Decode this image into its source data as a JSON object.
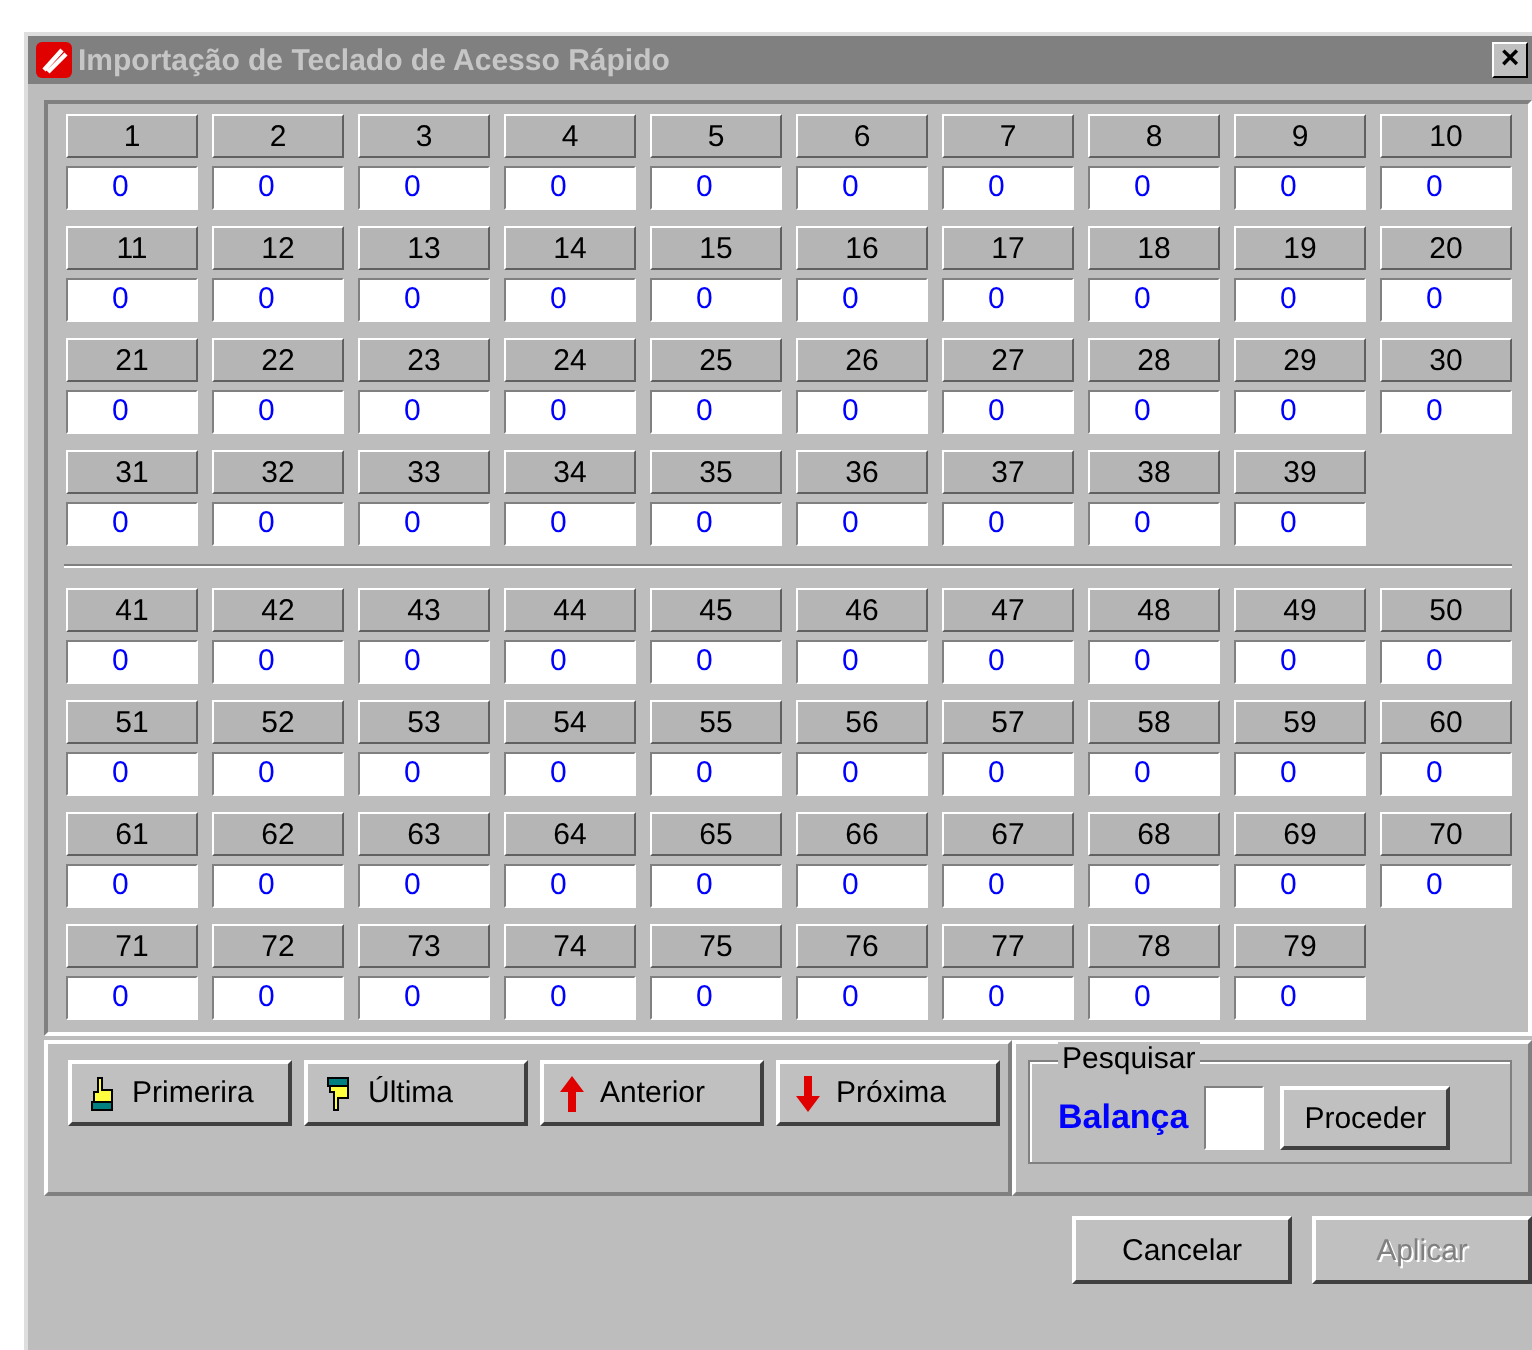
{
  "window": {
    "title": "Importação de Teclado de Acesso Rápido",
    "close": "×"
  },
  "key_groups": [
    {
      "keys": [
        {
          "label": "1",
          "value": "0"
        },
        {
          "label": "2",
          "value": "0"
        },
        {
          "label": "3",
          "value": "0"
        },
        {
          "label": "4",
          "value": "0"
        },
        {
          "label": "5",
          "value": "0"
        },
        {
          "label": "6",
          "value": "0"
        },
        {
          "label": "7",
          "value": "0"
        },
        {
          "label": "8",
          "value": "0"
        },
        {
          "label": "9",
          "value": "0"
        },
        {
          "label": "10",
          "value": "0"
        },
        {
          "label": "11",
          "value": "0"
        },
        {
          "label": "12",
          "value": "0"
        },
        {
          "label": "13",
          "value": "0"
        },
        {
          "label": "14",
          "value": "0"
        },
        {
          "label": "15",
          "value": "0"
        },
        {
          "label": "16",
          "value": "0"
        },
        {
          "label": "17",
          "value": "0"
        },
        {
          "label": "18",
          "value": "0"
        },
        {
          "label": "19",
          "value": "0"
        },
        {
          "label": "20",
          "value": "0"
        },
        {
          "label": "21",
          "value": "0"
        },
        {
          "label": "22",
          "value": "0"
        },
        {
          "label": "23",
          "value": "0"
        },
        {
          "label": "24",
          "value": "0"
        },
        {
          "label": "25",
          "value": "0"
        },
        {
          "label": "26",
          "value": "0"
        },
        {
          "label": "27",
          "value": "0"
        },
        {
          "label": "28",
          "value": "0"
        },
        {
          "label": "29",
          "value": "0"
        },
        {
          "label": "30",
          "value": "0"
        },
        {
          "label": "31",
          "value": "0"
        },
        {
          "label": "32",
          "value": "0"
        },
        {
          "label": "33",
          "value": "0"
        },
        {
          "label": "34",
          "value": "0"
        },
        {
          "label": "35",
          "value": "0"
        },
        {
          "label": "36",
          "value": "0"
        },
        {
          "label": "37",
          "value": "0"
        },
        {
          "label": "38",
          "value": "0"
        },
        {
          "label": "39",
          "value": "0"
        }
      ]
    },
    {
      "keys": [
        {
          "label": "41",
          "value": "0"
        },
        {
          "label": "42",
          "value": "0"
        },
        {
          "label": "43",
          "value": "0"
        },
        {
          "label": "44",
          "value": "0"
        },
        {
          "label": "45",
          "value": "0"
        },
        {
          "label": "46",
          "value": "0"
        },
        {
          "label": "47",
          "value": "0"
        },
        {
          "label": "48",
          "value": "0"
        },
        {
          "label": "49",
          "value": "0"
        },
        {
          "label": "50",
          "value": "0"
        },
        {
          "label": "51",
          "value": "0"
        },
        {
          "label": "52",
          "value": "0"
        },
        {
          "label": "53",
          "value": "0"
        },
        {
          "label": "54",
          "value": "0"
        },
        {
          "label": "55",
          "value": "0"
        },
        {
          "label": "56",
          "value": "0"
        },
        {
          "label": "57",
          "value": "0"
        },
        {
          "label": "58",
          "value": "0"
        },
        {
          "label": "59",
          "value": "0"
        },
        {
          "label": "60",
          "value": "0"
        },
        {
          "label": "61",
          "value": "0"
        },
        {
          "label": "62",
          "value": "0"
        },
        {
          "label": "63",
          "value": "0"
        },
        {
          "label": "64",
          "value": "0"
        },
        {
          "label": "65",
          "value": "0"
        },
        {
          "label": "66",
          "value": "0"
        },
        {
          "label": "67",
          "value": "0"
        },
        {
          "label": "68",
          "value": "0"
        },
        {
          "label": "69",
          "value": "0"
        },
        {
          "label": "70",
          "value": "0"
        },
        {
          "label": "71",
          "value": "0"
        },
        {
          "label": "72",
          "value": "0"
        },
        {
          "label": "73",
          "value": "0"
        },
        {
          "label": "74",
          "value": "0"
        },
        {
          "label": "75",
          "value": "0"
        },
        {
          "label": "76",
          "value": "0"
        },
        {
          "label": "77",
          "value": "0"
        },
        {
          "label": "78",
          "value": "0"
        },
        {
          "label": "79",
          "value": "0"
        }
      ]
    }
  ],
  "nav_buttons": [
    {
      "label": "Primerira",
      "kind": "first"
    },
    {
      "label": "Última",
      "kind": "last"
    },
    {
      "label": "Anterior",
      "kind": "previous"
    },
    {
      "label": "Próxima",
      "kind": "next"
    }
  ],
  "search": {
    "title": "Pesquisar",
    "label": "Balança",
    "button": "Proceder"
  },
  "buttons": [
    {
      "label": "Cancelar",
      "disabled": false
    },
    {
      "label": "Aplicar",
      "disabled": true
    }
  ]
}
